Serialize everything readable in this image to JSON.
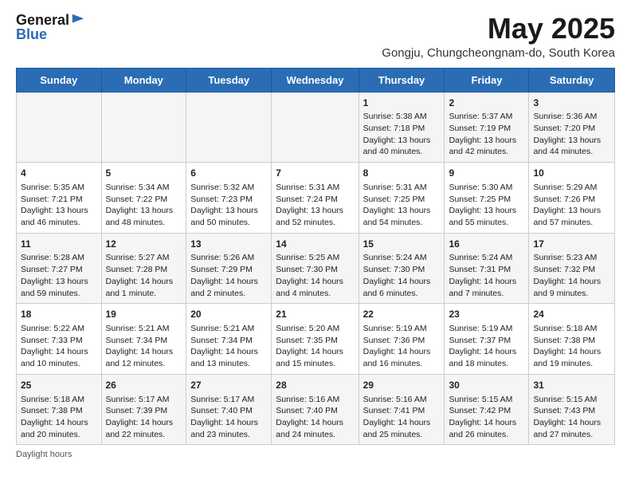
{
  "header": {
    "logo_general": "General",
    "logo_blue": "Blue",
    "month_title": "May 2025",
    "subtitle": "Gongju, Chungcheongnam-do, South Korea"
  },
  "weekdays": [
    "Sunday",
    "Monday",
    "Tuesday",
    "Wednesday",
    "Thursday",
    "Friday",
    "Saturday"
  ],
  "weeks": [
    [
      {
        "day": "",
        "info": ""
      },
      {
        "day": "",
        "info": ""
      },
      {
        "day": "",
        "info": ""
      },
      {
        "day": "",
        "info": ""
      },
      {
        "day": "1",
        "info": "Sunrise: 5:38 AM\nSunset: 7:18 PM\nDaylight: 13 hours and 40 minutes."
      },
      {
        "day": "2",
        "info": "Sunrise: 5:37 AM\nSunset: 7:19 PM\nDaylight: 13 hours and 42 minutes."
      },
      {
        "day": "3",
        "info": "Sunrise: 5:36 AM\nSunset: 7:20 PM\nDaylight: 13 hours and 44 minutes."
      }
    ],
    [
      {
        "day": "4",
        "info": "Sunrise: 5:35 AM\nSunset: 7:21 PM\nDaylight: 13 hours and 46 minutes."
      },
      {
        "day": "5",
        "info": "Sunrise: 5:34 AM\nSunset: 7:22 PM\nDaylight: 13 hours and 48 minutes."
      },
      {
        "day": "6",
        "info": "Sunrise: 5:32 AM\nSunset: 7:23 PM\nDaylight: 13 hours and 50 minutes."
      },
      {
        "day": "7",
        "info": "Sunrise: 5:31 AM\nSunset: 7:24 PM\nDaylight: 13 hours and 52 minutes."
      },
      {
        "day": "8",
        "info": "Sunrise: 5:31 AM\nSunset: 7:25 PM\nDaylight: 13 hours and 54 minutes."
      },
      {
        "day": "9",
        "info": "Sunrise: 5:30 AM\nSunset: 7:25 PM\nDaylight: 13 hours and 55 minutes."
      },
      {
        "day": "10",
        "info": "Sunrise: 5:29 AM\nSunset: 7:26 PM\nDaylight: 13 hours and 57 minutes."
      }
    ],
    [
      {
        "day": "11",
        "info": "Sunrise: 5:28 AM\nSunset: 7:27 PM\nDaylight: 13 hours and 59 minutes."
      },
      {
        "day": "12",
        "info": "Sunrise: 5:27 AM\nSunset: 7:28 PM\nDaylight: 14 hours and 1 minute."
      },
      {
        "day": "13",
        "info": "Sunrise: 5:26 AM\nSunset: 7:29 PM\nDaylight: 14 hours and 2 minutes."
      },
      {
        "day": "14",
        "info": "Sunrise: 5:25 AM\nSunset: 7:30 PM\nDaylight: 14 hours and 4 minutes."
      },
      {
        "day": "15",
        "info": "Sunrise: 5:24 AM\nSunset: 7:30 PM\nDaylight: 14 hours and 6 minutes."
      },
      {
        "day": "16",
        "info": "Sunrise: 5:24 AM\nSunset: 7:31 PM\nDaylight: 14 hours and 7 minutes."
      },
      {
        "day": "17",
        "info": "Sunrise: 5:23 AM\nSunset: 7:32 PM\nDaylight: 14 hours and 9 minutes."
      }
    ],
    [
      {
        "day": "18",
        "info": "Sunrise: 5:22 AM\nSunset: 7:33 PM\nDaylight: 14 hours and 10 minutes."
      },
      {
        "day": "19",
        "info": "Sunrise: 5:21 AM\nSunset: 7:34 PM\nDaylight: 14 hours and 12 minutes."
      },
      {
        "day": "20",
        "info": "Sunrise: 5:21 AM\nSunset: 7:34 PM\nDaylight: 14 hours and 13 minutes."
      },
      {
        "day": "21",
        "info": "Sunrise: 5:20 AM\nSunset: 7:35 PM\nDaylight: 14 hours and 15 minutes."
      },
      {
        "day": "22",
        "info": "Sunrise: 5:19 AM\nSunset: 7:36 PM\nDaylight: 14 hours and 16 minutes."
      },
      {
        "day": "23",
        "info": "Sunrise: 5:19 AM\nSunset: 7:37 PM\nDaylight: 14 hours and 18 minutes."
      },
      {
        "day": "24",
        "info": "Sunrise: 5:18 AM\nSunset: 7:38 PM\nDaylight: 14 hours and 19 minutes."
      }
    ],
    [
      {
        "day": "25",
        "info": "Sunrise: 5:18 AM\nSunset: 7:38 PM\nDaylight: 14 hours and 20 minutes."
      },
      {
        "day": "26",
        "info": "Sunrise: 5:17 AM\nSunset: 7:39 PM\nDaylight: 14 hours and 22 minutes."
      },
      {
        "day": "27",
        "info": "Sunrise: 5:17 AM\nSunset: 7:40 PM\nDaylight: 14 hours and 23 minutes."
      },
      {
        "day": "28",
        "info": "Sunrise: 5:16 AM\nSunset: 7:40 PM\nDaylight: 14 hours and 24 minutes."
      },
      {
        "day": "29",
        "info": "Sunrise: 5:16 AM\nSunset: 7:41 PM\nDaylight: 14 hours and 25 minutes."
      },
      {
        "day": "30",
        "info": "Sunrise: 5:15 AM\nSunset: 7:42 PM\nDaylight: 14 hours and 26 minutes."
      },
      {
        "day": "31",
        "info": "Sunrise: 5:15 AM\nSunset: 7:43 PM\nDaylight: 14 hours and 27 minutes."
      }
    ]
  ],
  "footer": {
    "daylight_label": "Daylight hours"
  }
}
